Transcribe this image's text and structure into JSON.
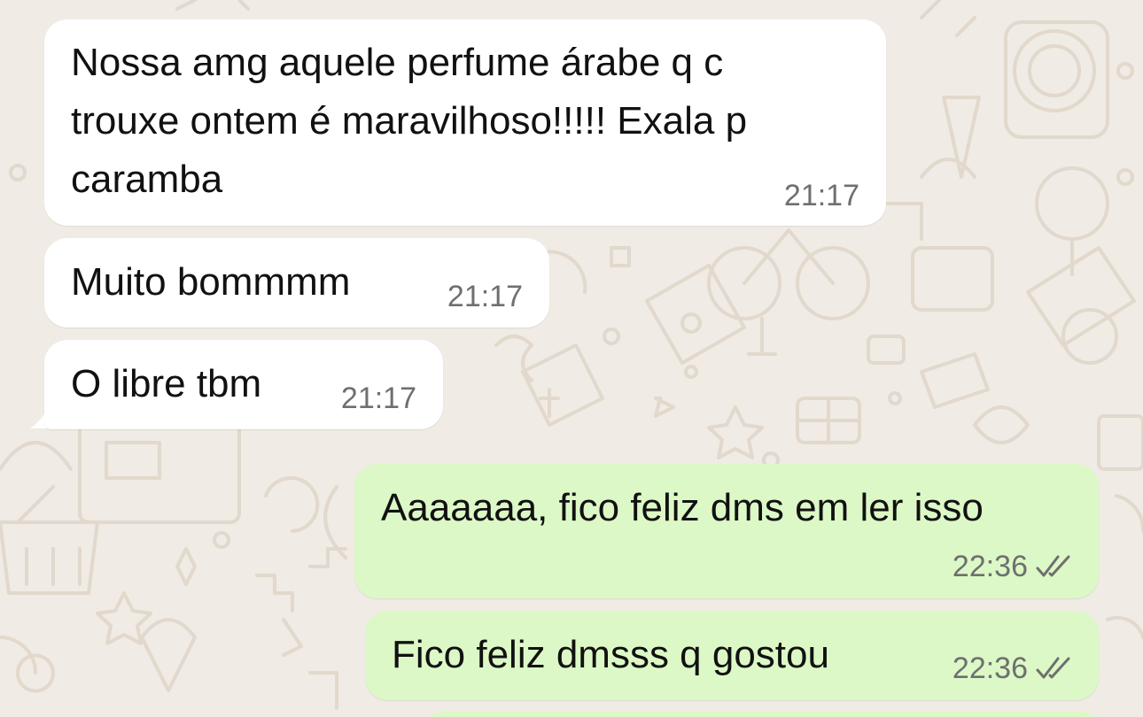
{
  "theme": {
    "wallpaper": "#f0ebe4",
    "incoming_bubble": "#ffffff",
    "outgoing_bubble": "#dcf8c6",
    "time_color": "#6f6f6f",
    "tick_color": "#6f6f6f"
  },
  "messages": [
    {
      "direction": "incoming",
      "text": "Nossa amg aquele perfume árabe q c\ntrouxe ontem é maravilhoso!!!!! Exala p\ncaramba",
      "time": "21:17"
    },
    {
      "direction": "incoming",
      "text": "Muito bommmm",
      "time": "21:17"
    },
    {
      "direction": "incoming",
      "text": "O libre tbm",
      "time": "21:17"
    },
    {
      "direction": "outgoing",
      "text": "Aaaaaaa, fico feliz dms em ler isso",
      "time": "22:36",
      "status_icon": "double-check-icon"
    },
    {
      "direction": "outgoing",
      "text": "Fico feliz dmsss q gostou",
      "time": "22:36",
      "status_icon": "double-check-icon"
    }
  ]
}
